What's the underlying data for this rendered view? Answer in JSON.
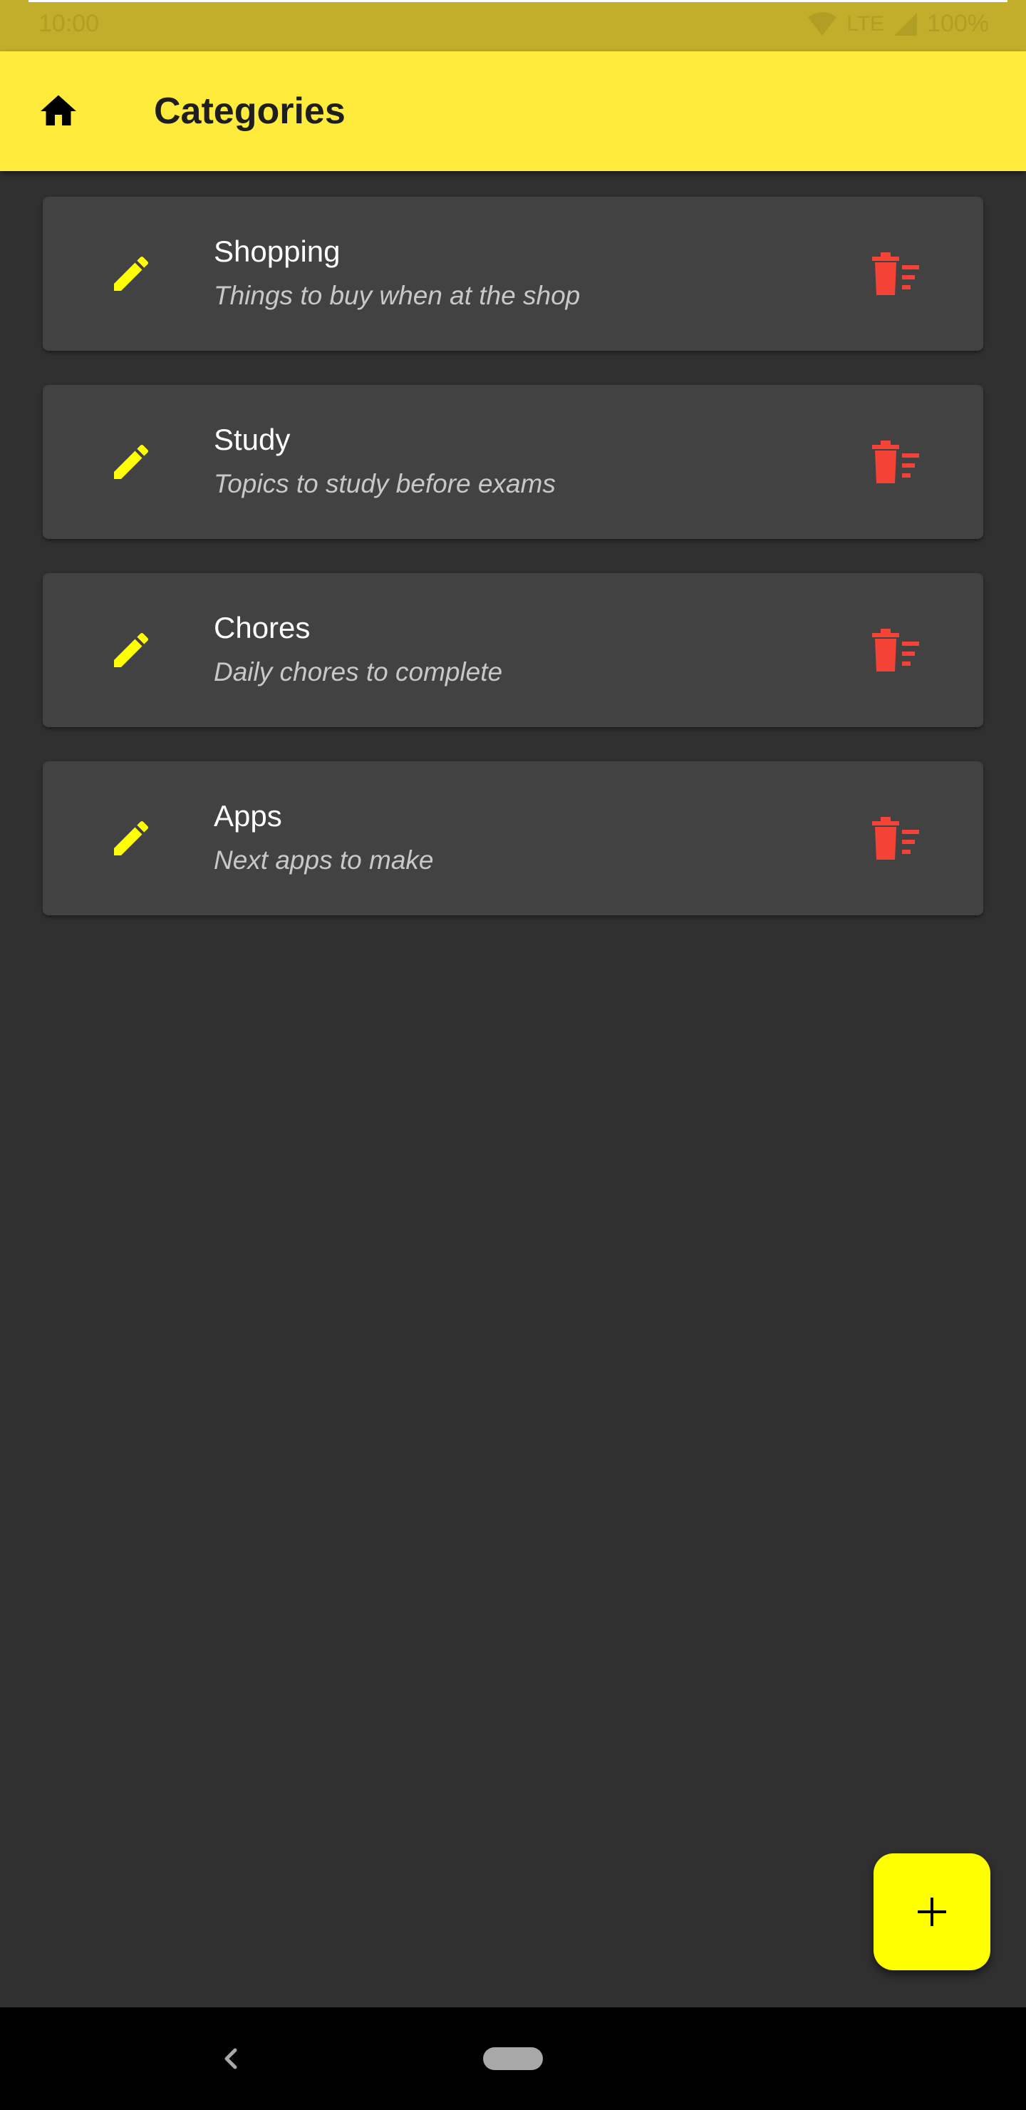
{
  "status_bar": {
    "time": "10:00",
    "network": "LTE",
    "battery": "100%"
  },
  "app_bar": {
    "title": "Categories",
    "home_icon": "home-icon"
  },
  "categories": [
    {
      "title": "Shopping",
      "subtitle": "Things to buy when at the shop"
    },
    {
      "title": "Study",
      "subtitle": "Topics to study before exams"
    },
    {
      "title": "Chores",
      "subtitle": "Daily chores to complete"
    },
    {
      "title": "Apps",
      "subtitle": "Next apps to make"
    }
  ],
  "icons": {
    "edit": "pencil-icon",
    "delete": "delete-sweep-icon",
    "fab": "plus-icon"
  },
  "colors": {
    "app_bar": "#ffeb3b",
    "status_bar": "#c2ae2b",
    "background": "#303030",
    "card": "#424242",
    "edit_icon": "#ffff00",
    "delete_icon": "#f44336",
    "fab": "#ffff00"
  }
}
